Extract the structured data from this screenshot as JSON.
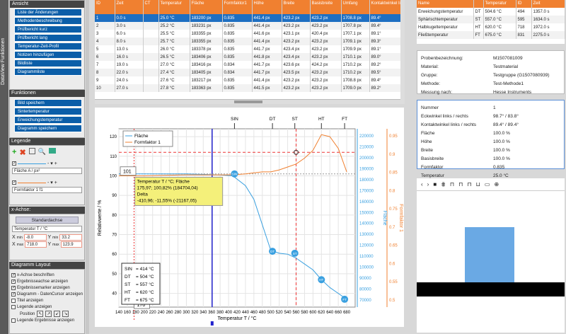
{
  "side_tab": "DataView Funktionen",
  "ansicht": {
    "title": "Ansicht",
    "items": [
      "Liste der Änderungen",
      "Methodenbeschreibung",
      "Prüfbericht kurz",
      "Prüfbericht lang",
      "Temperatur-Zeit-Profil",
      "Notizen hinzufügen",
      "Bildliste",
      "Diagrammliste"
    ]
  },
  "funktionen": {
    "title": "Funktionen",
    "items": [
      "Bild speichern",
      "Sintertemperatur",
      "Erweichungstemperatur",
      "Diagramm speichern"
    ]
  },
  "legende": {
    "title": "Legende",
    "row1": "Fläche A / px²",
    "row2": "Formfaktor 1 f1"
  },
  "xachse": {
    "title": "x-Achse:",
    "std": "Standardachse",
    "axis": "Temperatur T / °C",
    "xmin_l": "X",
    "xmin_sub": "min",
    "xmin": "-8.0",
    "ymin_l": "Y",
    "ymin_sub": "min",
    "ymin": "33.2",
    "xmax_l": "X",
    "xmax_sub": "max",
    "xmax": "718.0",
    "ymax_l": "Y",
    "ymax_sub": "max",
    "ymax": "123.9"
  },
  "layout": {
    "title": "Diagramm Layout",
    "checks": [
      {
        "label": "x-Achse beschriften",
        "on": true
      },
      {
        "label": "Ergebnisseachse anzeigen",
        "on": true
      },
      {
        "label": "Ergebnissemarker anzeigen",
        "on": true
      },
      {
        "label": "Diagramm - DatenCursor anzeigen",
        "on": true
      },
      {
        "label": "Titel anzeigen",
        "on": false
      },
      {
        "label": "Legende anzeigen",
        "on": false
      }
    ],
    "position": "Position",
    "last": "Legende Ergebnisse anzeigen"
  },
  "table": {
    "headers": [
      "ID",
      "Zeit",
      "CT",
      "Temperatur",
      "Fläche",
      "Formfaktor1",
      "Höhe",
      "Breite",
      "Basisbreite",
      "Umfang",
      "Kontaktwinkel links"
    ],
    "rows": [
      [
        "1",
        "0.0 s",
        "",
        "25.0 °C",
        "183200 px",
        "0.835",
        "441.4 px",
        "423.2 px",
        "423.2 px",
        "1708.8 px",
        "89.4°"
      ],
      [
        "2",
        "3.0 s",
        "",
        "25.2 °C",
        "183231 px",
        "0.835",
        "441.4 px",
        "423.2 px",
        "423.2 px",
        "1707.8 px",
        "89.4°"
      ],
      [
        "3",
        "6.0 s",
        "",
        "25.5 °C",
        "183355 px",
        "0.835",
        "441.6 px",
        "423.1 px",
        "420.4 px",
        "1707.1 px",
        "89.1°"
      ],
      [
        "4",
        "8.0 s",
        "",
        "25.7 °C",
        "183355 px",
        "0.835",
        "441.4 px",
        "423.2 px",
        "423.2 px",
        "1709.1 px",
        "89.3°"
      ],
      [
        "5",
        "13.0 s",
        "",
        "26.0 °C",
        "183378 px",
        "0.835",
        "441.7 px",
        "423.4 px",
        "423.2 px",
        "1709.9 px",
        "89.1°"
      ],
      [
        "6",
        "16.0 s",
        "",
        "26.5 °C",
        "183406 px",
        "0.835",
        "441.8 px",
        "423.4 px",
        "423.2 px",
        "1710.1 px",
        "89.0°"
      ],
      [
        "7",
        "19.0 s",
        "",
        "27.0 °C",
        "183416 px",
        "0.834",
        "441.7 px",
        "423.6 px",
        "424.2 px",
        "1710.2 px",
        "89.2°"
      ],
      [
        "8",
        "22.0 s",
        "",
        "27.4 °C",
        "183405 px",
        "0.834",
        "441.7 px",
        "423.5 px",
        "423.2 px",
        "1710.2 px",
        "89.5°"
      ],
      [
        "9",
        "24.0 s",
        "",
        "27.6 °C",
        "183217 px",
        "0.835",
        "441.4 px",
        "423.2 px",
        "423.2 px",
        "1708.8 px",
        "89.4°"
      ],
      [
        "10",
        "27.0 s",
        "",
        "27.8 °C",
        "183363 px",
        "0.835",
        "441.5 px",
        "423.2 px",
        "423.2 px",
        "1709.0 px",
        "89.2°"
      ]
    ]
  },
  "temps": {
    "headers": [
      "Name",
      "",
      "Temperatur",
      "ID",
      "Zeit"
    ],
    "rows": [
      [
        "Erweichungstemperatur",
        "DT",
        "504.6 °C",
        "494",
        "1357.0 s"
      ],
      [
        "Sphärischtemperatur",
        "ST",
        "557.0 °C",
        "595",
        "1634.0 s"
      ],
      [
        "Halbkugeltemperatur",
        "HT",
        "620.0 °C",
        "718",
        "1972.0 s"
      ],
      [
        "Fließtemperatur",
        "FT",
        "675.0 °C",
        "831",
        "2275.0 s"
      ]
    ]
  },
  "probe": [
    [
      "Probenbezeichnung:",
      "M1507081009"
    ],
    [
      "Material:",
      "Testmaterial"
    ],
    [
      "Gruppe:",
      "Testgruppe (G1507080939)"
    ],
    [
      "Methode:",
      "Test-Methode1"
    ],
    [
      "Messung nach:",
      "Hesse Instruments"
    ]
  ],
  "results": [
    [
      "Nummer",
      "1"
    ],
    [
      "Eckwinkel links / rechts",
      "98.7° / 83.8°"
    ],
    [
      "Kontaktwinkel links / rechts",
      "89.4° / 89.4°"
    ],
    [
      "Fläche",
      "100.0 %"
    ],
    [
      "Höhe",
      "100.0 %"
    ],
    [
      "Breite",
      "100.0 %"
    ],
    [
      "Basisbreite",
      "100.0 %"
    ],
    [
      "Formfaktor",
      "0.835"
    ],
    [
      "Temperatur",
      "25.0 °C"
    ]
  ],
  "cursor": {
    "l1": "Temperatur T / °C; Fläche",
    "l2": "175,97; 100,82% (184704,04)",
    "l3": "Delta",
    "l4": "-410,96; -11,55% (-21167,05)",
    "xval": "176",
    "yval": "101"
  },
  "markers_box": [
    [
      "SIN",
      "= 414 °C"
    ],
    [
      "DT",
      "= 504 °C"
    ],
    [
      "ST",
      "= 557 °C"
    ],
    [
      "HT",
      "= 620 °C"
    ],
    [
      "FT",
      "= 675 °C"
    ]
  ],
  "chart_data": {
    "type": "line",
    "xlabel": "Temperatur T / °C",
    "ylabel": "Relativwerte / %",
    "y2label": "Fläche",
    "y3label": "Formfaktor 1",
    "xlim": [
      140,
      700
    ],
    "ylim": [
      33,
      124
    ],
    "xticks": [
      140,
      160,
      180,
      200,
      220,
      240,
      260,
      280,
      300,
      320,
      340,
      360,
      380,
      400,
      420,
      440,
      460,
      480,
      500,
      520,
      540,
      560,
      580,
      600,
      620,
      640,
      660,
      680
    ],
    "yticks": [
      40,
      50,
      60,
      70,
      80,
      90,
      100,
      110,
      120
    ],
    "y2ticks": [
      "70000",
      "80000",
      "90000",
      "100000",
      "110000",
      "120000",
      "130000",
      "140000",
      "150000",
      "160000",
      "170000",
      "180000",
      "190000",
      "200000",
      "210000",
      "220000"
    ],
    "y3ticks": [
      "0.5",
      "0.55",
      "0.6",
      "0.65",
      "0.7",
      "0.75",
      "0.8",
      "0.85",
      "0.9",
      "0.95"
    ],
    "series": [
      {
        "name": "Fläche",
        "color": "#3aa0e0",
        "x": [
          140,
          200,
          300,
          380,
          410,
          440,
          460,
          480,
          500,
          520,
          540,
          560,
          580,
          600,
          620,
          640,
          660,
          680
        ],
        "y": [
          101,
          101,
          101,
          100.5,
          100,
          95,
          88,
          75,
          62,
          60.5,
          60,
          58,
          55,
          52,
          47,
          43,
          40,
          37
        ]
      },
      {
        "name": "Formfaktor 1",
        "color": "#f08030",
        "x": [
          140,
          200,
          300,
          380,
          410,
          440,
          460,
          480,
          500,
          520,
          540,
          560,
          580,
          600,
          610,
          620,
          640,
          660,
          680
        ],
        "y": [
          100,
          100,
          100.5,
          100.5,
          100.5,
          101,
          101.5,
          102,
          102,
          103,
          104.5,
          106,
          109,
          113,
          117,
          121,
          120,
          114,
          102
        ]
      }
    ],
    "markers": [
      {
        "label": "SIN",
        "x": 414,
        "y": 101
      },
      {
        "label": "DT",
        "x": 504,
        "y": 61.5
      },
      {
        "label": "ST",
        "x": 557,
        "y": 60.5
      },
      {
        "label": "HT",
        "x": 620,
        "y": 47
      },
      {
        "label": "FT",
        "x": 675,
        "y": 37
      }
    ]
  }
}
